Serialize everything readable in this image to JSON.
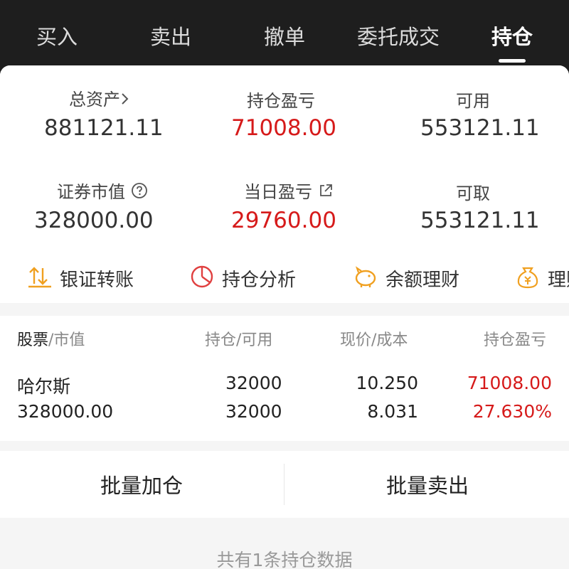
{
  "tabs": [
    {
      "label": "买入"
    },
    {
      "label": "卖出"
    },
    {
      "label": "撤单"
    },
    {
      "label": "委托成交"
    },
    {
      "label": "持仓",
      "active": true
    }
  ],
  "summary": {
    "total_assets_label": "总资产",
    "total_assets_value": "881121.11",
    "position_pnl_label": "持仓盈亏",
    "position_pnl_value": "71008.00",
    "available_label": "可用",
    "available_value": "553121.11",
    "market_value_label": "证券市值",
    "market_value_value": "328000.00",
    "daily_pnl_label": "当日盈亏",
    "daily_pnl_value": "29760.00",
    "withdrawable_label": "可取",
    "withdrawable_value": "553121.11"
  },
  "actions": [
    {
      "label": "银证转账",
      "icon": "transfer-icon"
    },
    {
      "label": "持仓分析",
      "icon": "pie-chart-icon"
    },
    {
      "label": "余额理财",
      "icon": "piggy-bank-icon"
    },
    {
      "label": "理财",
      "icon": "money-bag-icon"
    }
  ],
  "table": {
    "headers": {
      "stock": "股票",
      "market_value": "/市值",
      "position": "持仓/可用",
      "price": "现价/成本",
      "pnl": "持仓盈亏"
    },
    "rows": [
      {
        "name": "哈尔斯",
        "market_value": "328000.00",
        "position": "32000",
        "available": "32000",
        "price": "10.250",
        "cost": "8.031",
        "pnl": "71008.00",
        "pnl_pct": "27.630%"
      }
    ]
  },
  "buttons": {
    "batch_add": "批量加仓",
    "batch_sell": "批量卖出"
  },
  "footer": "共有1条持仓数据",
  "colors": {
    "profit_red": "#d61a1a",
    "accent_orange": "#f0a020",
    "dark_bg": "#1e1e1e"
  }
}
